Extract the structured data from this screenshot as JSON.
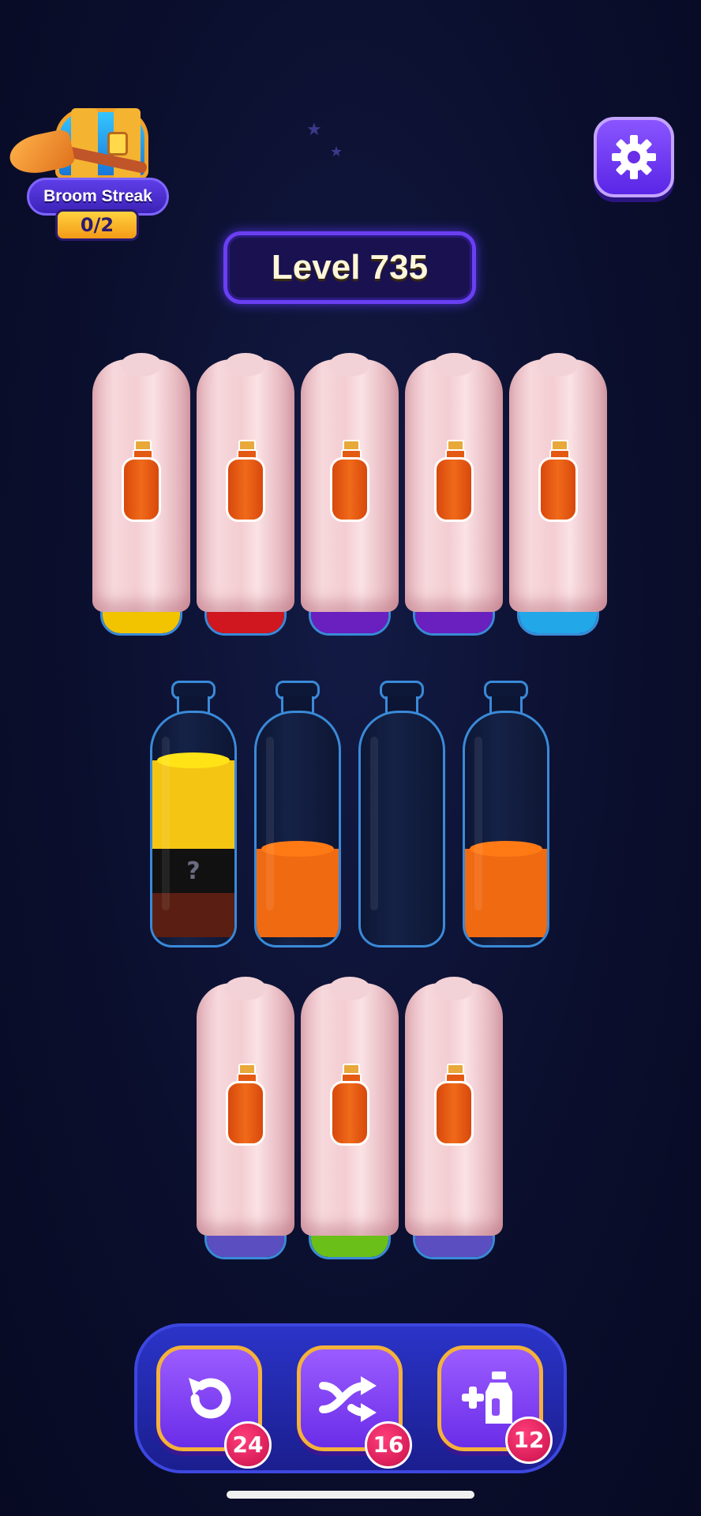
{
  "broom_streak": {
    "label": "Broom Streak",
    "count": "0/2"
  },
  "level": {
    "label": "Level 735"
  },
  "covered_row_top": [
    {
      "base_color": "#f2c400"
    },
    {
      "base_color": "#d0161e"
    },
    {
      "base_color": "#6a1fbf"
    },
    {
      "base_color": "#6a1fbf"
    },
    {
      "base_color": "#22a7e8"
    }
  ],
  "open_bottles": [
    {
      "segments": [
        {
          "color": "#f5c513",
          "kind": "liquid",
          "units": 2
        },
        {
          "color": "#111111",
          "kind": "hidden",
          "units": 1,
          "label": "?"
        },
        {
          "color": "#5a1e12",
          "kind": "liquid",
          "units": 1
        }
      ]
    },
    {
      "segments": [
        {
          "color": "#f06a12",
          "kind": "liquid",
          "units": 2
        }
      ]
    },
    {
      "segments": []
    },
    {
      "segments": [
        {
          "color": "#f06a12",
          "kind": "liquid",
          "units": 2
        }
      ]
    }
  ],
  "covered_row_bottom": [
    {
      "base_color": "#5a4ec0"
    },
    {
      "base_color": "#6ac018"
    },
    {
      "base_color": "#5a4ec0"
    }
  ],
  "powerups": [
    {
      "name": "undo",
      "icon": "undo-icon",
      "count": "24"
    },
    {
      "name": "shuffle",
      "icon": "shuffle-icon",
      "count": "16"
    },
    {
      "name": "add-bottle",
      "icon": "add-bottle-icon",
      "count": "12"
    }
  ],
  "colors": {
    "accent": "#6a3ff2",
    "badge": "#e0145a",
    "frame": "#f4b23a"
  }
}
